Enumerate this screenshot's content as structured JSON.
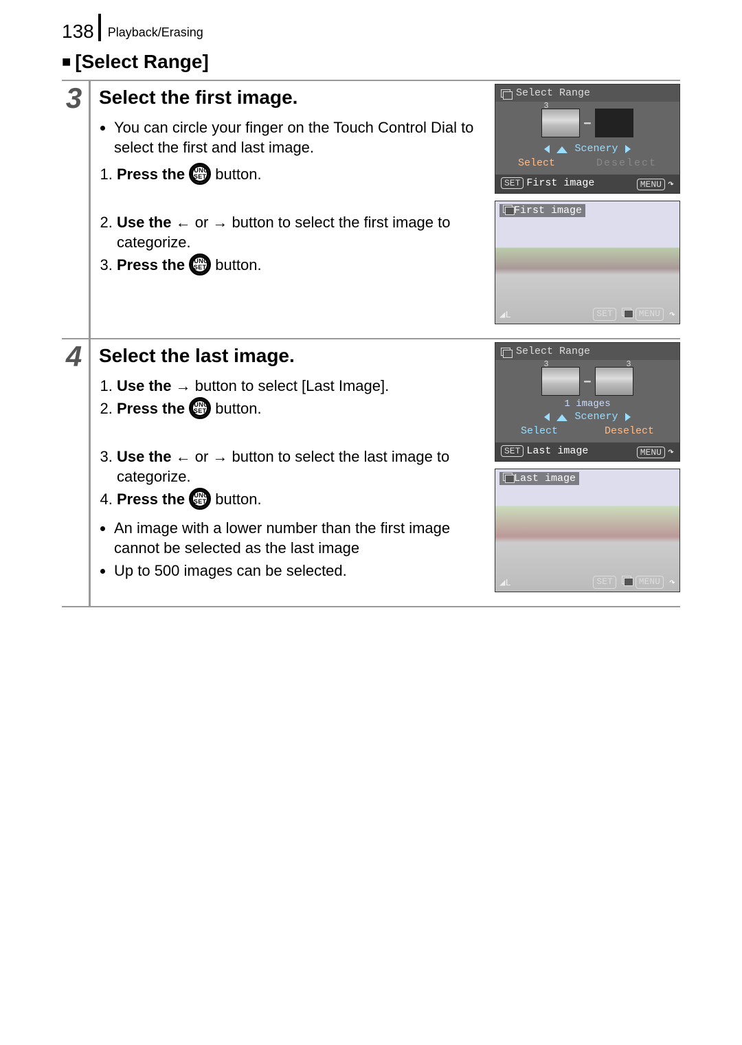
{
  "header": {
    "page_number": "138",
    "breadcrumb": "Playback/Erasing"
  },
  "section": {
    "title": "[Select Range]"
  },
  "step3": {
    "number": "3",
    "heading": "Select the first image.",
    "bullet1": "You can circle your finger on the Touch Control Dial to select the first and last image.",
    "item1_a": "Press the ",
    "item1_b": " button.",
    "item2_a": "Use the ",
    "item2_b": " or ",
    "item2_c": " button to select the first image to categorize.",
    "item3_a": "Press the ",
    "item3_b": " button."
  },
  "step4": {
    "number": "4",
    "heading": "Select the last image.",
    "item1_a": "Use the ",
    "item1_b": " button to select [Last Image].",
    "item2_a": "Press the ",
    "item2_b": " button.",
    "item3_a": "Use the ",
    "item3_b": " or ",
    "item3_c": " button to select the last image to categorize.",
    "item4_a": "Press the ",
    "item4_b": " button.",
    "note1": "An image with a lower number than the first image cannot be selected as the last image",
    "note2": "Up to 500 images can be selected."
  },
  "icons": {
    "func": "FUNC.",
    "set": "SET",
    "left": "←",
    "right": "→",
    "menu": "MENU",
    "back": "↶"
  },
  "lcd1": {
    "title": "Select Range",
    "thumb_num": "3",
    "category": "Scenery",
    "select": "Select",
    "deselect": "Deselect",
    "foot_left": "First image"
  },
  "lcd2": {
    "title": "First image",
    "corner": "◢L"
  },
  "lcd3": {
    "title": "Select Range",
    "thumb_a": "3",
    "thumb_b": "3",
    "images": "1 images",
    "category": "Scenery",
    "select": "Select",
    "deselect": "Deselect",
    "foot_left": "Last image"
  },
  "lcd4": {
    "title": "Last image",
    "corner": "◢L"
  }
}
